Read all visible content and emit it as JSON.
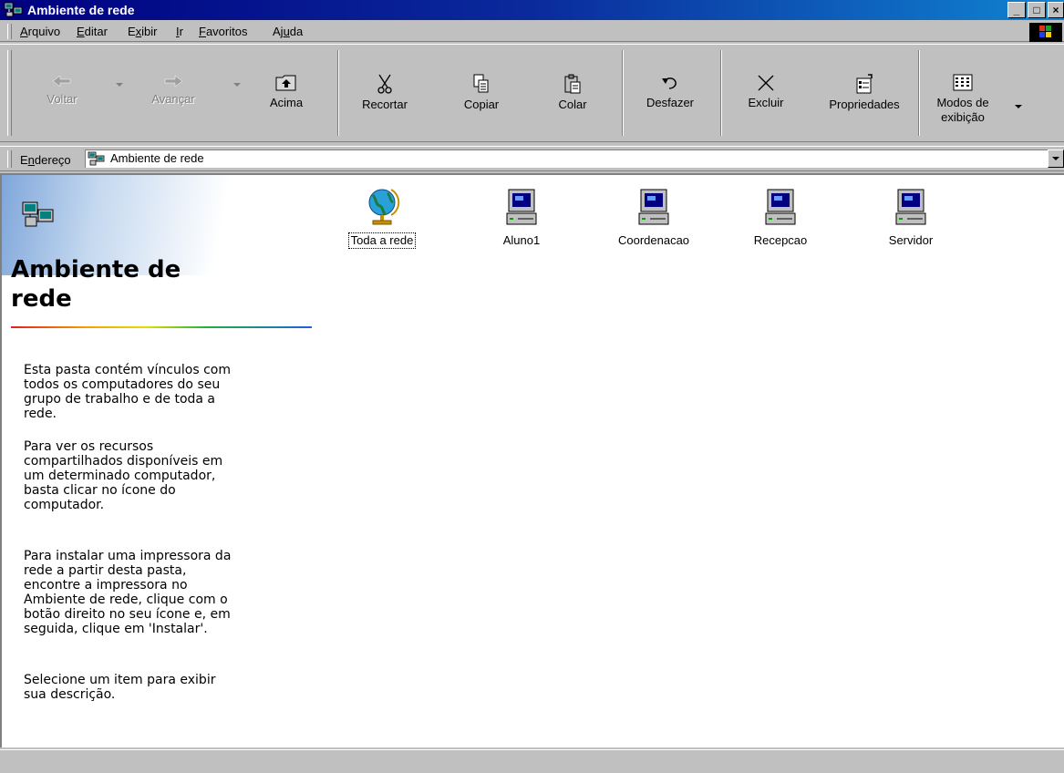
{
  "window": {
    "title": "Ambiente de rede",
    "icon": "network-neighborhood-icon",
    "controls": {
      "minimize": "_",
      "maximize": "□",
      "close": "×"
    }
  },
  "menu": {
    "items": [
      {
        "pre": "",
        "key": "A",
        "post": "rquivo"
      },
      {
        "pre": "",
        "key": "E",
        "post": "ditar"
      },
      {
        "pre": "E",
        "key": "x",
        "post": "ibir"
      },
      {
        "pre": "",
        "key": "I",
        "post": "r"
      },
      {
        "pre": "",
        "key": "F",
        "post": "avoritos"
      },
      {
        "pre": "Aj",
        "key": "u",
        "post": "da"
      }
    ]
  },
  "toolbar": {
    "back": "Voltar",
    "forward": "Avançar",
    "up": "Acima",
    "cut": "Recortar",
    "copy": "Copiar",
    "paste": "Colar",
    "undo": "Desfazer",
    "delete": "Excluir",
    "properties": "Propriedades",
    "views_line1": "Modos de",
    "views_line2": "exibição"
  },
  "address": {
    "label_pre": "E",
    "label_key": "n",
    "label_post": "dereço",
    "value": "Ambiente de rede"
  },
  "panel": {
    "title": "Ambiente de\nrede",
    "paragraphs": [
      "Esta pasta contém vínculos com\ntodos os computadores do seu\ngrupo de trabalho e de toda a\nrede.",
      "Para ver os recursos\ncompartilhados disponíveis em\num determinado computador,\nbasta clicar no ícone do\ncomputador.",
      "Para instalar uma impressora da\nrede a partir desta pasta,\nencontre a impressora no\nAmbiente de rede, clique com o\nbotão direito no seu ícone e, em\nseguida, clique em 'Instalar'.",
      "Selecione um item para exibir\nsua descrição."
    ]
  },
  "items": [
    {
      "label": "Toda a rede",
      "icon": "globe-icon"
    },
    {
      "label": "Aluno1",
      "icon": "computer-icon"
    },
    {
      "label": "Coordenacao",
      "icon": "computer-icon"
    },
    {
      "label": "Recepcao",
      "icon": "computer-icon"
    },
    {
      "label": "Servidor",
      "icon": "computer-icon"
    }
  ],
  "status": {
    "text": ""
  }
}
